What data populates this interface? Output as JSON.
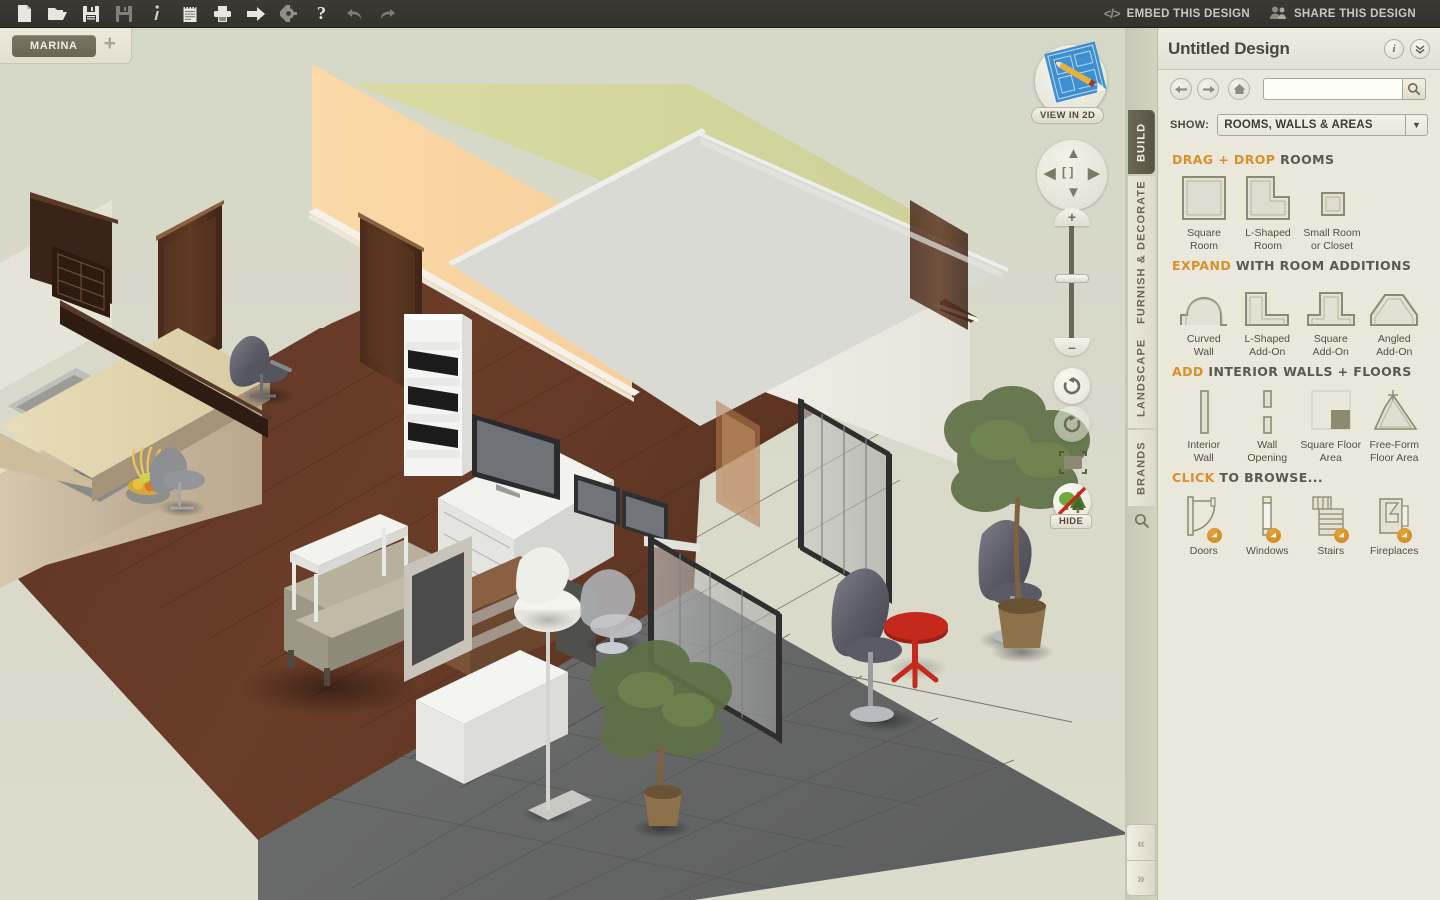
{
  "toolbar": {
    "icons": [
      {
        "name": "new-file-icon",
        "label": "New"
      },
      {
        "name": "open-folder-icon",
        "label": "Open"
      },
      {
        "name": "save-icon",
        "label": "Save"
      },
      {
        "name": "save-as-icon",
        "label": "Save As"
      },
      {
        "name": "info-icon",
        "label": "Info"
      },
      {
        "name": "notes-icon",
        "label": "Notes"
      },
      {
        "name": "print-icon",
        "label": "Print"
      },
      {
        "name": "export-icon",
        "label": "Export"
      },
      {
        "name": "settings-gear-icon",
        "label": "Settings"
      },
      {
        "name": "help-icon",
        "label": "Help"
      },
      {
        "name": "undo-icon",
        "label": "Undo"
      },
      {
        "name": "redo-icon",
        "label": "Redo"
      }
    ],
    "embed_label": "EMBED THIS DESIGN",
    "share_label": "SHARE THIS DESIGN"
  },
  "project_tabs": {
    "active_tab": "MARINA",
    "add_label": "+"
  },
  "viewport": {
    "view_2d_label": "VIEW IN 2D",
    "hide_label": "HIDE",
    "nav": {
      "up": "▲",
      "down": "▼",
      "left": "◀",
      "right": "▶",
      "center": "[ ]"
    },
    "zoom": {
      "plus": "+",
      "minus": "–"
    }
  },
  "mode_tabs": [
    {
      "label": "BUILD",
      "active": true
    },
    {
      "label": "FURNISH & DECORATE",
      "active": false
    },
    {
      "label": "LANDSCAPE",
      "active": false
    },
    {
      "label": "BRANDS",
      "active": false
    }
  ],
  "panel": {
    "title": "Untitled Design",
    "info_glyph": "i",
    "collapse_glyph": "»",
    "nav_back": "←",
    "nav_forward": "→",
    "nav_home": "⌂",
    "search": {
      "value": "",
      "placeholder": ""
    },
    "show_label": "SHOW:",
    "show_value": "ROOMS, WALLS & AREAS",
    "sections": [
      {
        "id": "drag-drop-rooms",
        "accent": "DRAG + DROP",
        "rest": "ROOMS",
        "items": [
          {
            "name": "square-room",
            "label": "Square\nRoom"
          },
          {
            "name": "l-shaped-room",
            "label": "L-Shaped\nRoom"
          },
          {
            "name": "small-room-or-closet",
            "label": "Small Room\nor Closet"
          }
        ]
      },
      {
        "id": "expand-room-additions",
        "accent": "EXPAND",
        "rest": "WITH ROOM ADDITIONS",
        "items": [
          {
            "name": "curved-wall",
            "label": "Curved\nWall"
          },
          {
            "name": "l-shaped-add-on",
            "label": "L-Shaped\nAdd-On"
          },
          {
            "name": "square-add-on",
            "label": "Square\nAdd-On"
          },
          {
            "name": "angled-add-on",
            "label": "Angled\nAdd-On"
          }
        ]
      },
      {
        "id": "add-interior-walls-floors",
        "accent": "ADD",
        "rest": "INTERIOR WALLS + FLOORS",
        "items": [
          {
            "name": "interior-wall",
            "label": "Interior\nWall"
          },
          {
            "name": "wall-opening",
            "label": "Wall\nOpening"
          },
          {
            "name": "square-floor-area",
            "label": "Square Floor\nArea"
          },
          {
            "name": "free-form-floor-area",
            "label": "Free-Form\nFloor Area"
          }
        ]
      },
      {
        "id": "click-to-browse",
        "accent": "CLICK",
        "rest": "TO BROWSE...",
        "items": [
          {
            "name": "doors",
            "label": "Doors"
          },
          {
            "name": "windows",
            "label": "Windows"
          },
          {
            "name": "stairs",
            "label": "Stairs"
          },
          {
            "name": "fireplaces",
            "label": "Fireplaces"
          }
        ]
      }
    ]
  },
  "collapse": {
    "left_glyph": "«",
    "right_glyph": "»"
  },
  "colors": {
    "toolbar_bg": "#36352f",
    "panel_bg": "#e9e8db",
    "accent_orange": "#d98f2b",
    "text_dark": "#4b4739",
    "active_tab": "#605c4a",
    "canvas_bg": "#d7d8c9"
  }
}
